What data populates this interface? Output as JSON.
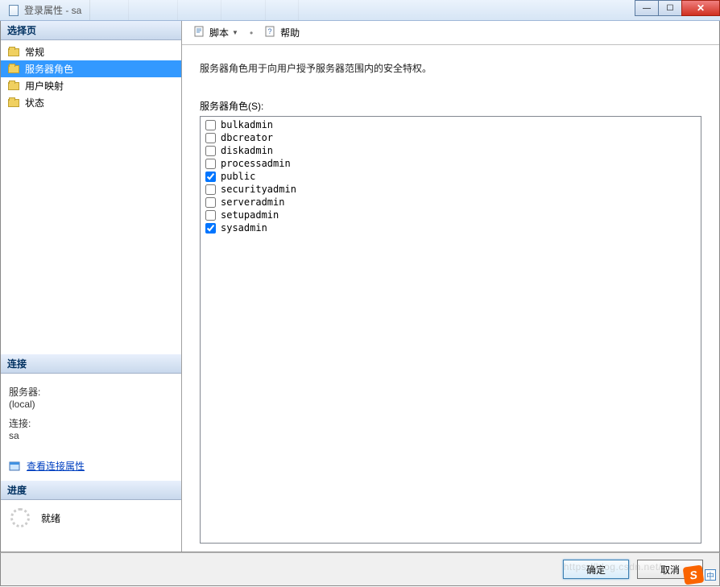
{
  "window": {
    "title": "登录属性 - sa"
  },
  "window_controls": {
    "min": "—",
    "max": "☐",
    "close": "✕"
  },
  "sidebar": {
    "select_page_header": "选择页",
    "pages": [
      {
        "label": "常规",
        "selected": false
      },
      {
        "label": "服务器角色",
        "selected": true
      },
      {
        "label": "用户映射",
        "selected": false
      },
      {
        "label": "状态",
        "selected": false
      }
    ],
    "connection_header": "连接",
    "server_label": "服务器:",
    "server_value": "(local)",
    "conn_label": "连接:",
    "conn_value": "sa",
    "view_props_link": "查看连接属性",
    "progress_header": "进度",
    "progress_status": "就绪"
  },
  "toolbar": {
    "script_label": "脚本",
    "help_label": "帮助"
  },
  "main": {
    "description": "服务器角色用于向用户授予服务器范围内的安全特权。",
    "roles_label": "服务器角色(S):",
    "roles": [
      {
        "name": "bulkadmin",
        "checked": false
      },
      {
        "name": "dbcreator",
        "checked": false
      },
      {
        "name": "diskadmin",
        "checked": false
      },
      {
        "name": "processadmin",
        "checked": false
      },
      {
        "name": "public",
        "checked": true
      },
      {
        "name": "securityadmin",
        "checked": false
      },
      {
        "name": "serveradmin",
        "checked": false
      },
      {
        "name": "setupadmin",
        "checked": false
      },
      {
        "name": "sysadmin",
        "checked": true
      }
    ]
  },
  "footer": {
    "ok": "确定",
    "cancel": "取消"
  },
  "ime": {
    "badge": "S",
    "lang": "中"
  },
  "watermark": "https://blog.csdn.net/..."
}
